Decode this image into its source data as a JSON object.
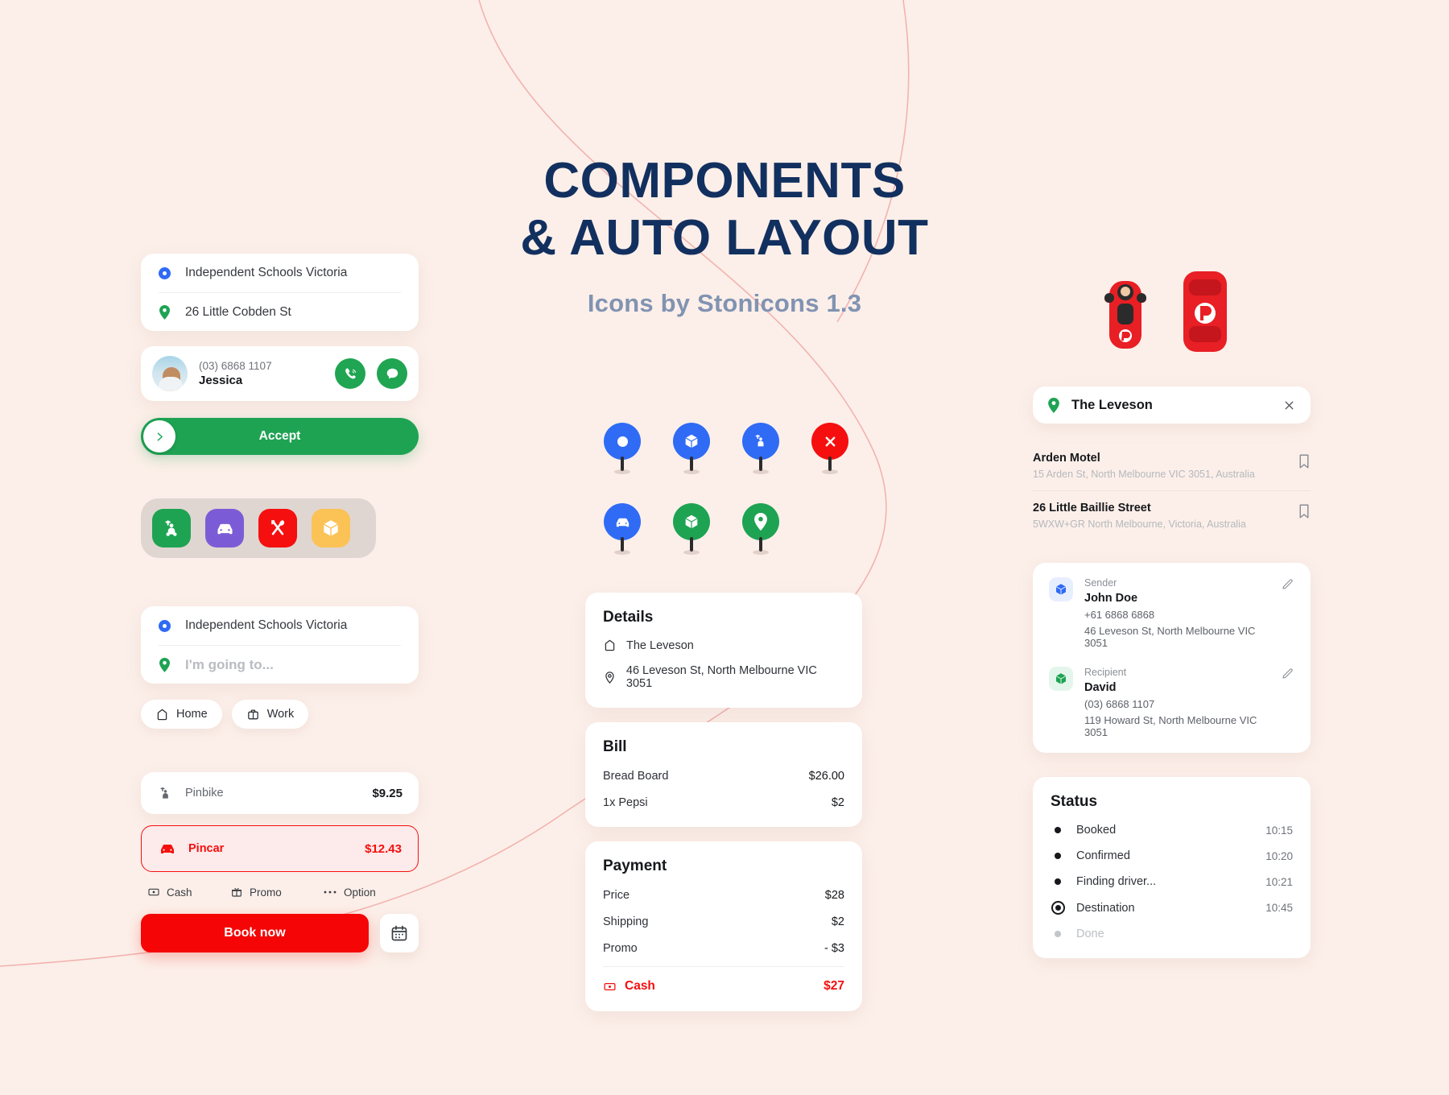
{
  "header": {
    "title_line1": "COMPONENTS",
    "title_line2": "& AUTO LAYOUT",
    "subtitle": "Icons by Stonicons 1.3",
    "title_color": "#12305f",
    "subtitle_color": "#8193b2"
  },
  "theme": {
    "background": "#fcefe9",
    "green": "#1ea353",
    "red": "#f50505",
    "blue": "#2f6bf5",
    "purple": "#7c5cd6",
    "yellow": "#fbc256",
    "navy": "#12305f"
  },
  "left": {
    "route_card": {
      "origin": "Independent Schools Victoria",
      "destination": "26 Little Cobden St"
    },
    "contact": {
      "phone": "(03) 6868 1107",
      "name": "Jessica",
      "call_icon": "phone-icon",
      "message_icon": "chat-icon"
    },
    "accept_button": {
      "label": "Accept",
      "knob_icon": "chevron-right-icon"
    },
    "service_tray": [
      {
        "name": "scooter",
        "icon": "scooter-icon",
        "color": "#1ea353"
      },
      {
        "name": "car",
        "icon": "car-icon",
        "color": "#7c5cd6"
      },
      {
        "name": "food",
        "icon": "fork-spoon-icon",
        "color": "#f50f0f"
      },
      {
        "name": "package",
        "icon": "box-icon",
        "color": "#fbc256"
      }
    ],
    "destination_card": {
      "origin": "Independent Schools Victoria",
      "destination_placeholder": "I'm going to..."
    },
    "chips": [
      {
        "label": "Home",
        "icon": "home-icon"
      },
      {
        "label": "Work",
        "icon": "briefcase-icon"
      }
    ],
    "fares": [
      {
        "name": "Pinbike",
        "price": "$9.25",
        "icon": "scooter-icon",
        "selected": false
      },
      {
        "name": "Pincar",
        "price": "$12.43",
        "icon": "car-icon",
        "selected": true
      }
    ],
    "payment_options": [
      {
        "label": "Cash",
        "icon": "cash-icon"
      },
      {
        "label": "Promo",
        "icon": "gift-icon"
      },
      {
        "label": "Option",
        "icon": "more-icon"
      }
    ],
    "book_button": {
      "label": "Book now"
    },
    "calendar_button": {
      "icon": "calendar-icon"
    }
  },
  "pins": [
    {
      "name": "dot-pin",
      "icon": "dot-icon",
      "color": "#2f6bf5"
    },
    {
      "name": "box-pin",
      "icon": "box-icon",
      "color": "#2f6bf5"
    },
    {
      "name": "scooter-pin",
      "icon": "scooter-icon",
      "color": "#2f6bf5"
    },
    {
      "name": "close-pin",
      "icon": "close-icon",
      "color": "#f50f0f"
    },
    {
      "name": "car-pin",
      "icon": "car-icon",
      "color": "#2f6bf5"
    },
    {
      "name": "box-green-pin",
      "icon": "box-icon",
      "color": "#1ea353"
    },
    {
      "name": "location-pin",
      "icon": "location-icon",
      "color": "#1ea353"
    }
  ],
  "center": {
    "details": {
      "title": "Details",
      "place": "The Leveson",
      "place_icon": "home-icon",
      "address": "46 Leveson St, North Melbourne VIC 3051",
      "address_icon": "location-icon"
    },
    "bill": {
      "title": "Bill",
      "items": [
        {
          "label": "Bread Board",
          "value": "$26.00"
        },
        {
          "label": "1x Pepsi",
          "value": "$2"
        }
      ]
    },
    "payment": {
      "title": "Payment",
      "items": [
        {
          "label": "Price",
          "value": "$28"
        },
        {
          "label": "Shipping",
          "value": "$2"
        },
        {
          "label": "Promo",
          "value": "- $3"
        }
      ],
      "total_label": "Cash",
      "total_icon": "cash-icon",
      "total_value": "$27"
    }
  },
  "right": {
    "search": {
      "value": "The Leveson",
      "pin_icon": "location-icon",
      "clear_icon": "close-icon"
    },
    "addresses": [
      {
        "title": "Arden Motel",
        "subtitle": "15 Arden St, North Melbourne VIC 3051, Australia",
        "bookmark_icon": "bookmark-icon"
      },
      {
        "title": "26 Little Baillie Street",
        "subtitle": "5WXW+GR North Melbourne, Victoria, Australia",
        "bookmark_icon": "bookmark-icon"
      }
    ],
    "people": [
      {
        "role": "Sender",
        "name": "John Doe",
        "phone": "+61 6868 6868",
        "address": "46 Leveson St, North Melbourne VIC 3051",
        "badge_icon": "box-icon",
        "badge_color": "#2f6bf5",
        "edit_icon": "pencil-icon"
      },
      {
        "role": "Recipient",
        "name": "David",
        "phone": "(03) 6868 1107",
        "address": "119 Howard St, North Melbourne VIC 3051",
        "badge_icon": "box-icon",
        "badge_color": "#1ea353",
        "edit_icon": "pencil-icon"
      }
    ],
    "status": {
      "title": "Status",
      "steps": [
        {
          "label": "Booked",
          "time": "10:15",
          "state": "done"
        },
        {
          "label": "Confirmed",
          "time": "10:20",
          "state": "done"
        },
        {
          "label": "Finding driver...",
          "time": "10:21",
          "state": "done"
        },
        {
          "label": "Destination",
          "time": "10:45",
          "state": "current"
        },
        {
          "label": "Done",
          "time": "",
          "state": "pending"
        }
      ]
    }
  },
  "vehicles": [
    {
      "name": "scooter-top-view",
      "color": "#e81f24"
    },
    {
      "name": "car-top-view",
      "color": "#e81f24"
    }
  ]
}
